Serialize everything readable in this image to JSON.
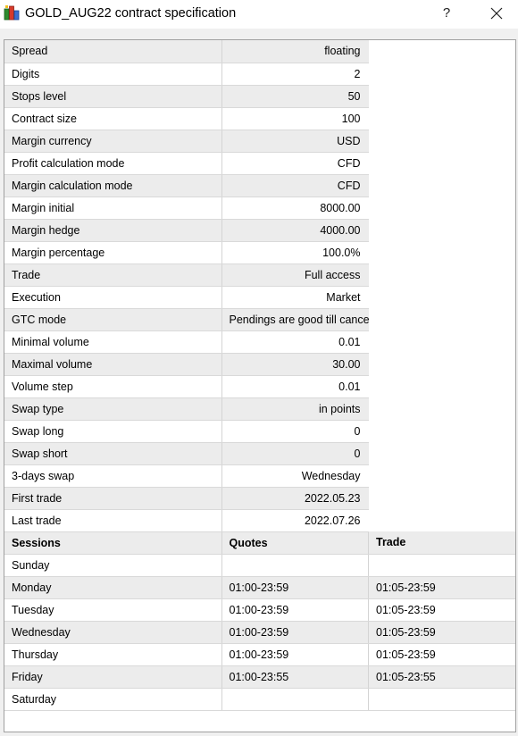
{
  "window": {
    "title": "GOLD_AUG22 contract specification",
    "help_label": "?",
    "icon": "terminal-app-icon"
  },
  "specs": [
    {
      "label": "Spread",
      "value": "floating"
    },
    {
      "label": "Digits",
      "value": "2"
    },
    {
      "label": "Stops level",
      "value": "50"
    },
    {
      "label": "Contract size",
      "value": "100"
    },
    {
      "label": "Margin currency",
      "value": "USD"
    },
    {
      "label": "Profit calculation mode",
      "value": "CFD"
    },
    {
      "label": "Margin calculation mode",
      "value": "CFD"
    },
    {
      "label": "Margin initial",
      "value": "8000.00"
    },
    {
      "label": "Margin hedge",
      "value": "4000.00"
    },
    {
      "label": "Margin percentage",
      "value": "100.0%"
    },
    {
      "label": "Trade",
      "value": "Full access"
    },
    {
      "label": "Execution",
      "value": "Market"
    },
    {
      "label": "GTC mode",
      "value": "Pendings are good till cancel"
    },
    {
      "label": "Minimal volume",
      "value": "0.01"
    },
    {
      "label": "Maximal volume",
      "value": "30.00"
    },
    {
      "label": "Volume step",
      "value": "0.01"
    },
    {
      "label": "Swap type",
      "value": "in points"
    },
    {
      "label": "Swap long",
      "value": "0"
    },
    {
      "label": "Swap short",
      "value": "0"
    },
    {
      "label": "3-days swap",
      "value": "Wednesday"
    },
    {
      "label": "First trade",
      "value": "2022.05.23"
    },
    {
      "label": "Last trade",
      "value": "2022.07.26"
    }
  ],
  "sessions": {
    "headers": [
      "Sessions",
      "Quotes",
      "Trade"
    ],
    "rows": [
      {
        "day": "Sunday",
        "quotes": "",
        "trade": ""
      },
      {
        "day": "Monday",
        "quotes": "01:00-23:59",
        "trade": "01:05-23:59"
      },
      {
        "day": "Tuesday",
        "quotes": "01:00-23:59",
        "trade": "01:05-23:59"
      },
      {
        "day": "Wednesday",
        "quotes": "01:00-23:59",
        "trade": "01:05-23:59"
      },
      {
        "day": "Thursday",
        "quotes": "01:00-23:59",
        "trade": "01:05-23:59"
      },
      {
        "day": "Friday",
        "quotes": "01:00-23:55",
        "trade": "01:05-23:55"
      },
      {
        "day": "Saturday",
        "quotes": "",
        "trade": ""
      }
    ]
  }
}
